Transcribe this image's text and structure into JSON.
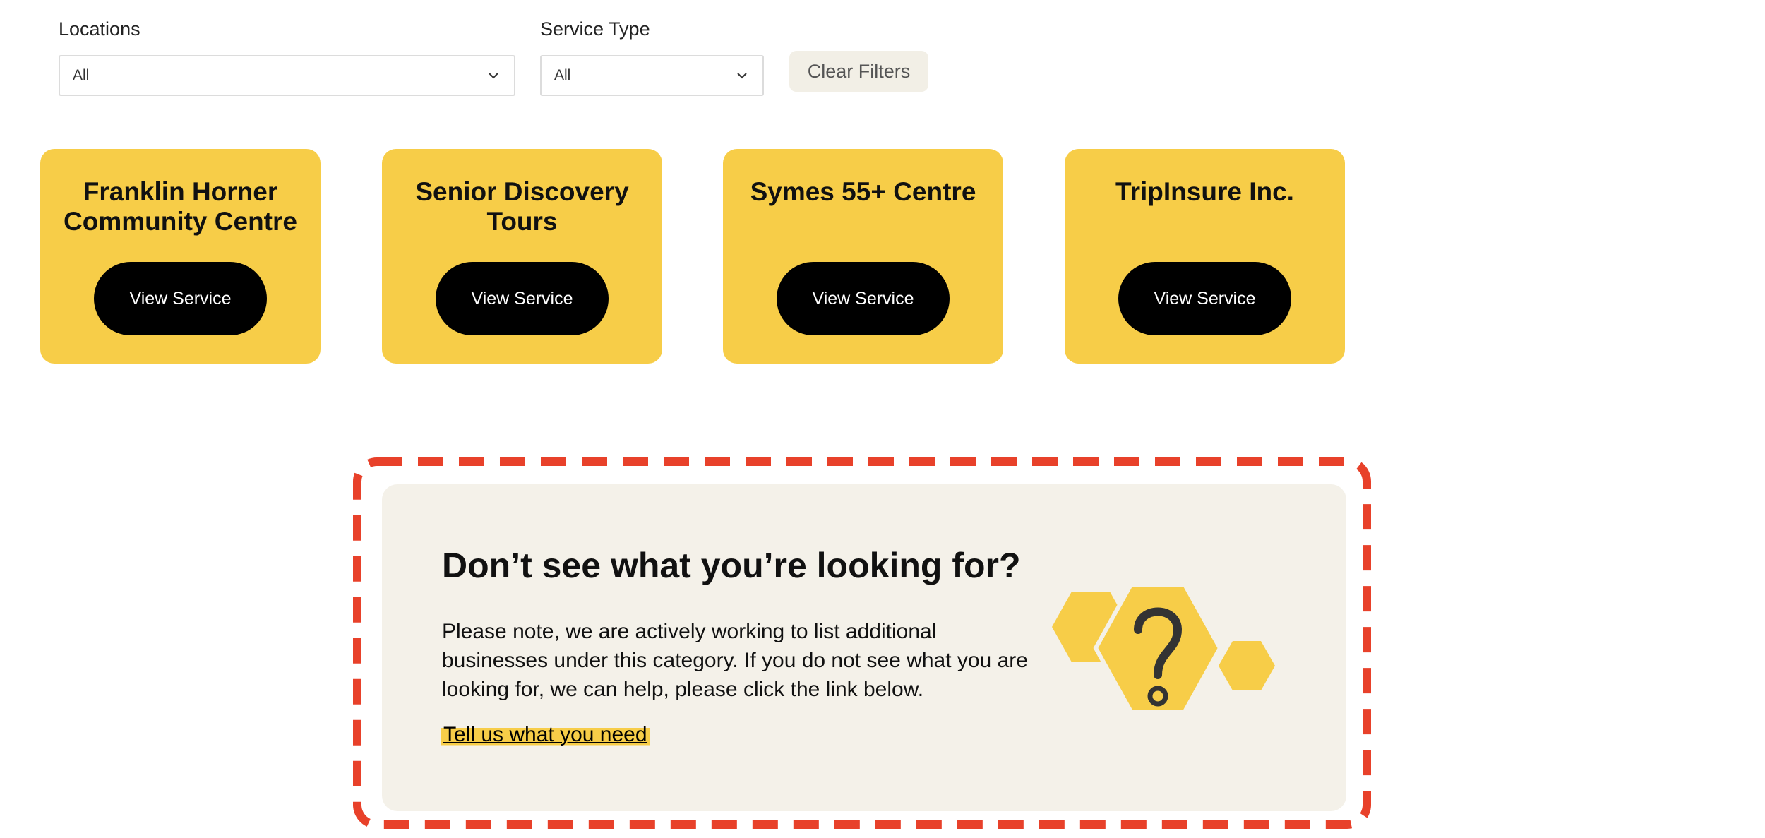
{
  "filters": {
    "locations": {
      "label": "Locations",
      "value": "All"
    },
    "service_type": {
      "label": "Service Type",
      "value": "All"
    },
    "clear_label": "Clear Filters"
  },
  "cards": [
    {
      "title_line1": "Franklin Horner",
      "title_line2": "Community Centre",
      "button": "View Service"
    },
    {
      "title_line1": "Senior Discovery",
      "title_line2": "Tours",
      "button": "View Service"
    },
    {
      "title_line1": "Symes 55+ Centre",
      "title_line2": "",
      "button": "View Service"
    },
    {
      "title_line1": "TripInsure Inc.",
      "title_line2": "",
      "button": "View Service"
    }
  ],
  "help_panel": {
    "title": "Don’t see what you’re looking for?",
    "body": "Please note, we are actively working to list additional businesses under this category. If you do not see what you are looking for, we can help, please click the link below.",
    "link": "Tell us what you need",
    "icon": "question-hexagon-icon"
  },
  "colors": {
    "accent_yellow": "#f7cd48",
    "panel_bg": "#f4f1e9",
    "dashed_border": "#e8412a",
    "button_black": "#000000"
  }
}
